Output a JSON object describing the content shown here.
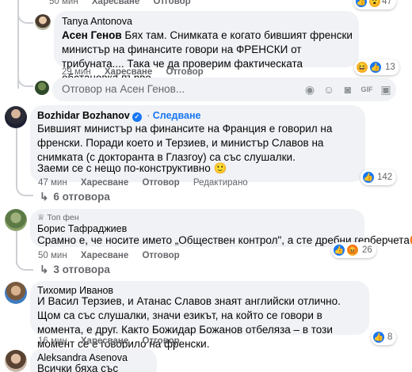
{
  "top": {
    "time": "50 мин",
    "like": "Харесване",
    "reply": "Отговор",
    "count": "47"
  },
  "c1": {
    "name": "Tanya Antonova",
    "tag": "Асен Генов",
    "text": " Бях там. Снимката е когато бившият френски министър на финансите говори на ФРЕНСКИ от трибуната.... Така че да проверим фактическата обстановка първо.",
    "count": "13",
    "time": "29 мин",
    "like": "Харесване",
    "reply": "Отговор"
  },
  "reply_input": {
    "placeholder": "Отговор на Асен Генов..."
  },
  "c2": {
    "name": "Bozhidar Bozhanov",
    "follow": "Следване",
    "text1": "Бившият министър на финансите на Франция е говорил на френски. Поради което и Терзиев, и министър Славов на снимката (с докторанта в Глазгоу) са със слушалки.",
    "text2": "Заеми се с нещо по-конструктивно 🙂",
    "count": "142",
    "time": "47 мин",
    "like": "Харесване",
    "reply": "Отговор",
    "edited": "Редактирано",
    "replies": "6 отговора"
  },
  "c3": {
    "badge": "Топ фен",
    "name": "Борис Тафраджиев",
    "text": "Срамно е, че носите името „Обществен контрол\", а сте дребни герберчета😡",
    "count": "26",
    "time": "50 мин",
    "like": "Харесване",
    "reply": "Отговор",
    "replies": "3 отговора"
  },
  "c4": {
    "name": "Тихомир Иванов",
    "text": "И Васил Терзиев, и Атанас Славов знаят английски отлично. Щом са със слушалки, значи езикът, на който се говори в момента, е друг. Както Божидар Божанов отбеляза – в този момент се е говорило на френски.",
    "count": "8",
    "time": "16 мин",
    "like": "Харесване",
    "reply": "Отговор"
  },
  "c5": {
    "name": "Aleksandra Asenova",
    "text": "Всички бяха със слушалки."
  }
}
